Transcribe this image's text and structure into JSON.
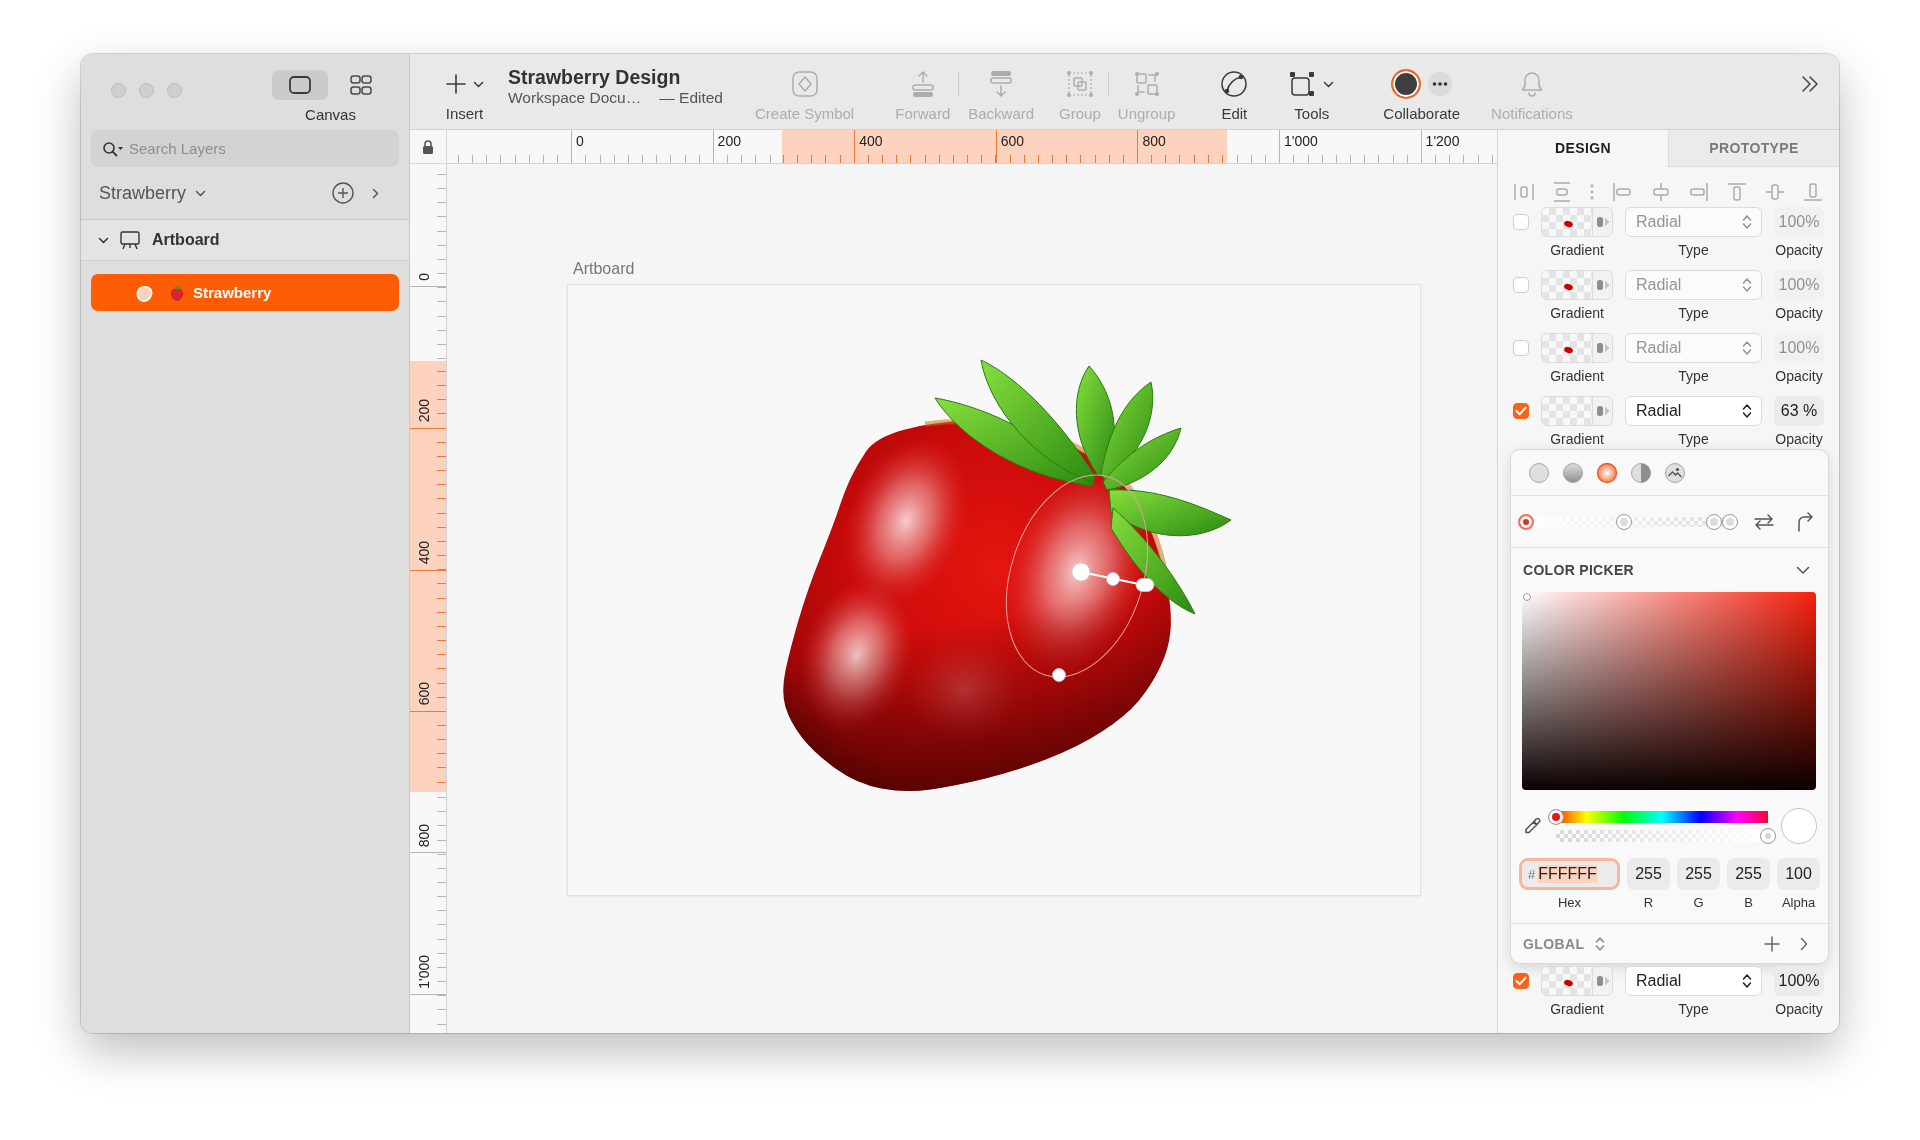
{
  "window": {
    "title": "Strawberry Design",
    "subtitle": "Workspace Docu…",
    "status": "— Edited"
  },
  "sidebar": {
    "view_switch": {
      "label": "Canvas",
      "options": [
        {
          "kind": "canvas",
          "selected": true
        },
        {
          "kind": "components",
          "selected": false
        }
      ]
    },
    "search": {
      "placeholder": "Search Layers"
    },
    "page": {
      "name": "Strawberry"
    },
    "layers": [
      {
        "kind": "artboard",
        "name": "Artboard",
        "expanded": true,
        "selected": false,
        "children": [
          {
            "kind": "shape",
            "name": "Strawberry",
            "selected": true
          }
        ]
      }
    ]
  },
  "toolbar": {
    "insert": {
      "label": "Insert"
    },
    "actions": [
      {
        "kind": "create_symbol",
        "label": "Create Symbol",
        "disabled": true
      },
      {
        "kind": "forward",
        "label": "Forward",
        "disabled": true
      },
      {
        "kind": "backward",
        "label": "Backward",
        "disabled": true
      },
      {
        "kind": "group",
        "label": "Group",
        "disabled": true
      },
      {
        "kind": "ungroup",
        "label": "Ungroup",
        "disabled": true
      },
      {
        "kind": "edit",
        "label": "Edit",
        "disabled": false
      },
      {
        "kind": "tools",
        "label": "Tools",
        "disabled": false
      },
      {
        "kind": "collaborate",
        "label": "Collaborate",
        "disabled": false
      },
      {
        "kind": "notifications",
        "label": "Notifications",
        "disabled": true
      }
    ]
  },
  "canvas": {
    "rulers": {
      "horizontal": [
        "0",
        "200",
        "400",
        "600",
        "800",
        "1'000",
        "1'200"
      ],
      "vertical": [
        "0",
        "200",
        "400",
        "600",
        "800",
        "1'000"
      ]
    },
    "artboard": {
      "name": "Artboard"
    }
  },
  "inspector": {
    "tabs": [
      {
        "label": "DESIGN",
        "selected": true
      },
      {
        "label": "PROTOTYPE",
        "selected": false
      }
    ],
    "alignment": {
      "disabled": true
    },
    "fills": [
      {
        "checked": false,
        "color": "#cc0000",
        "swatch_label": "Gradient",
        "type": "Radial",
        "type_label": "Type",
        "opacity": "100%",
        "opacity_label": "Opacity"
      },
      {
        "checked": false,
        "color": "#cc0000",
        "swatch_label": "Gradient",
        "type": "Radial",
        "type_label": "Type",
        "opacity": "100%",
        "opacity_label": "Opacity"
      },
      {
        "checked": false,
        "color": "#cc0000",
        "swatch_label": "Gradient",
        "type": "Radial",
        "type_label": "Type",
        "opacity": "100%",
        "opacity_label": "Opacity"
      },
      {
        "checked": true,
        "swatch_label": "Gradient",
        "type": "Radial",
        "type_label": "Type",
        "opacity": "63 %",
        "opacity_label": "Opacity"
      }
    ],
    "popover": {
      "fill_types": [
        {
          "kind": "solid",
          "selected": false
        },
        {
          "kind": "linear",
          "selected": false
        },
        {
          "kind": "radial",
          "selected": true
        },
        {
          "kind": "angular",
          "selected": false
        },
        {
          "kind": "image",
          "selected": false
        }
      ],
      "gradient_stops": [
        {
          "level": 0,
          "selected": true
        },
        {
          "level": 0.48,
          "selected": false
        },
        {
          "level": 0.92,
          "selected": false
        },
        {
          "level": 1,
          "selected": false
        }
      ],
      "color_picker": {
        "title": "COLOR PICKER",
        "expanded": true,
        "hue": {
          "level": 0
        },
        "alpha": {
          "level": 1
        },
        "hex": {
          "prefix": "#",
          "value": "FFFFFF",
          "label": "Hex",
          "focused": true
        },
        "channels": [
          {
            "value": "255",
            "label": "R"
          },
          {
            "value": "255",
            "label": "G"
          },
          {
            "value": "255",
            "label": "B"
          },
          {
            "value": "100",
            "label": "Alpha"
          }
        ]
      },
      "swatches": {
        "label": "GLOBAL"
      }
    },
    "more_fills": [
      {
        "checked": true,
        "color": "#cc0000",
        "swatch_label": "Gradient",
        "type": "Radial",
        "type_label": "Type",
        "opacity": "100%",
        "opacity_label": "Opacity"
      }
    ]
  }
}
